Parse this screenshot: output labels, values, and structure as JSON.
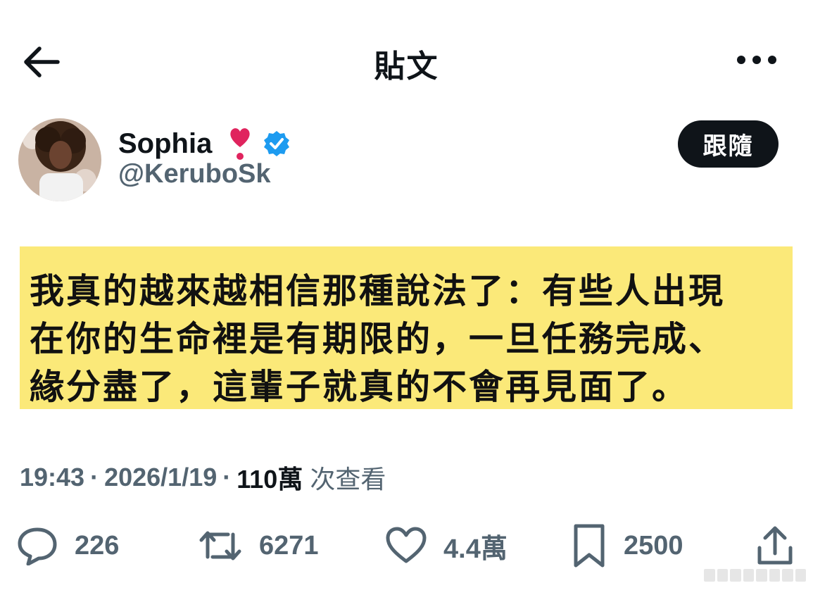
{
  "header": {
    "title": "貼文",
    "back_icon": "arrow-left-icon",
    "more_icon": "more-horizontal-icon"
  },
  "author": {
    "display_name": "Sophia",
    "emoji_icon": "heart-exclamation-icon",
    "verified_icon": "verified-badge-icon",
    "handle": "@KeruboSk",
    "follow_label": "跟隨"
  },
  "tweet": {
    "lines": [
      "我真的越來越相信那種說法了：有些人出現",
      "在你的生命裡是有期限的，一旦任務完成、",
      "緣分盡了，這輩子就真的不會再見面了。"
    ],
    "highlight_color": "#fbe979"
  },
  "meta": {
    "time": "19:43",
    "separator": "·",
    "date": "2026/1/19",
    "views_count": "110萬",
    "views_label": "次查看"
  },
  "actions": {
    "reply": {
      "icon": "reply-icon",
      "count": "226"
    },
    "retweet": {
      "icon": "retweet-icon",
      "count": "6271"
    },
    "like": {
      "icon": "heart-icon",
      "count": "4.4萬"
    },
    "bookmark": {
      "icon": "bookmark-icon",
      "count": "2500"
    },
    "share": {
      "icon": "share-icon"
    }
  },
  "colors": {
    "text": "#0f1419",
    "muted": "#536471",
    "verified": "#1d9bf0",
    "heart": "#e0245e"
  }
}
